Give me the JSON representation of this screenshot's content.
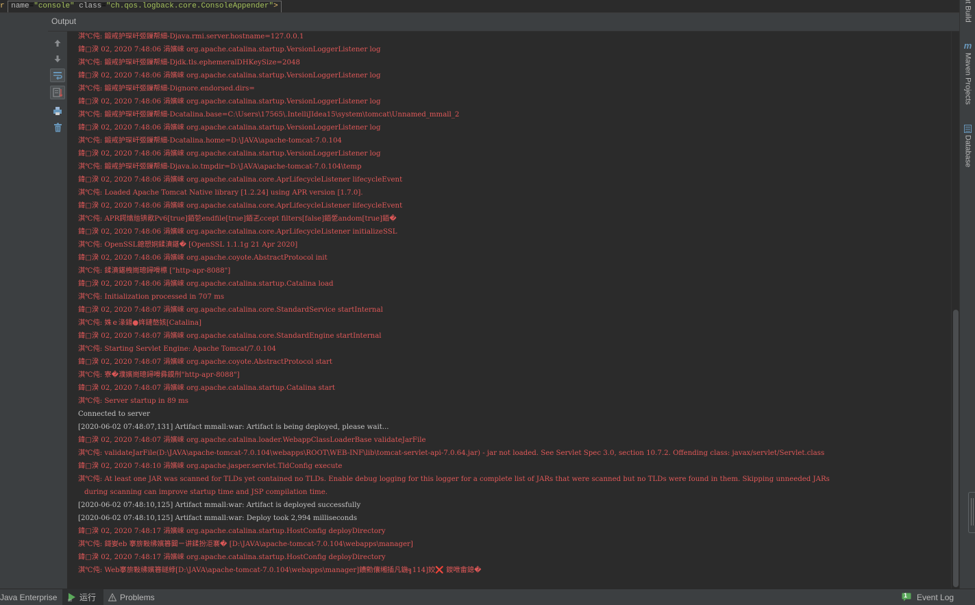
{
  "editor": {
    "attr_name": "name",
    "attr_name_value": "\"console\"",
    "attr_class": "class",
    "attr_class_value": "\"ch.qos.logback.core.ConsoleAppender\"",
    "tag_close": ">",
    "leading_glyph": "r"
  },
  "output_panel": {
    "title": "Output"
  },
  "toolbar": {
    "buttons": [
      {
        "icon": "up-arrow-icon",
        "label": "up"
      },
      {
        "icon": "down-arrow-icon",
        "label": "down"
      },
      {
        "icon": "soft-wrap-icon",
        "label": "wrap"
      },
      {
        "icon": "scroll-to-end-icon",
        "label": "scroll"
      },
      {
        "icon": "print-icon",
        "label": "print"
      },
      {
        "icon": "trash-icon",
        "label": "clear"
      }
    ]
  },
  "console": {
    "lines": [
      {
        "text": "淇℃伅: 鍛戒护琛屽弬鏁帮細-Djava.rmi.server.hostname=127.0.0.1",
        "type": "err"
      },
      {
        "text": "鍏□湀 02, 2020 7:48:06 涓嬪崍 org.apache.catalina.startup.VersionLoggerListener log",
        "type": "err"
      },
      {
        "text": "淇℃伅: 鍛戒护琛屽弬鏁帮細-Djdk.tls.ephemeralDHKeySize=2048",
        "type": "err"
      },
      {
        "text": "鍏□湀 02, 2020 7:48:06 涓嬪崍 org.apache.catalina.startup.VersionLoggerListener log",
        "type": "err"
      },
      {
        "text": "淇℃伅: 鍛戒护琛屽弬鏁帮細-Dignore.endorsed.dirs=",
        "type": "err"
      },
      {
        "text": "鍏□湀 02, 2020 7:48:06 涓嬪崍 org.apache.catalina.startup.VersionLoggerListener log",
        "type": "err"
      },
      {
        "text": "淇℃伅: 鍛戒护琛屽弬鏁帮細-Dcatalina.base=C:\\Users\\17565\\.IntelliJIdea15\\system\\tomcat\\Unnamed_mmall_2",
        "type": "err"
      },
      {
        "text": "鍏□湀 02, 2020 7:48:06 涓嬪崍 org.apache.catalina.startup.VersionLoggerListener log",
        "type": "err"
      },
      {
        "text": "淇℃伅: 鍛戒护琛屽弬鏁帮細-Dcatalina.home=D:\\JAVA\\apache-tomcat-7.0.104",
        "type": "err"
      },
      {
        "text": "鍏□湀 02, 2020 7:48:06 涓嬪崍 org.apache.catalina.startup.VersionLoggerListener log",
        "type": "err"
      },
      {
        "text": "淇℃伅: 鍛戒护琛屽弬鏁帮細-Djava.io.tmpdir=D:\\JAVA\\apache-tomcat-7.0.104\\temp",
        "type": "err"
      },
      {
        "text": "鍏□湀 02, 2020 7:48:06 涓嬪崍 org.apache.catalina.core.AprLifecycleListener lifecycleEvent",
        "type": "err"
      },
      {
        "text": "淇℃伅: Loaded Apache Tomcat Native library [1.2.24] using APR version [1.7.0].",
        "type": "err"
      },
      {
        "text": "鍏□湀 02, 2020 7:48:06 涓嬪崍 org.apache.catalina.core.AprLifecycleListener lifecycleEvent",
        "type": "err"
      },
      {
        "text": "淇℃伅: APR鍔熻兘锛歄Pv6[true]銆乻endfile[true]銆乤ccept filters[false]銆乺andom[true]銆�",
        "type": "err"
      },
      {
        "text": "鍏□湀 02, 2020 7:48:06 涓嬪崍 org.apache.catalina.core.AprLifecycleListener initializeSSL",
        "type": "err"
      },
      {
        "text": "淇℃伅: OpenSSL鎴愬姛鍒濆鍖� [OpenSSL 1.1.1g  21 Apr 2020]",
        "type": "err"
      },
      {
        "text": "鍏□湀 02, 2020 7:48:06 涓嬪崍 org.apache.coyote.AbstractProtocol init",
        "type": "err"
      },
      {
        "text": "淇℃伅: 鍒濆鍖栧崗璁鐞嗗櫒 [\"http-apr-8088\"]",
        "type": "err"
      },
      {
        "text": "鍏□湀 02, 2020 7:48:06 涓嬪崍 org.apache.catalina.startup.Catalina load",
        "type": "err"
      },
      {
        "text": "淇℃伅: Initialization processed in 707 ms",
        "type": "err"
      },
      {
        "text": "鍏□湀 02, 2020 7:48:07 涓嬪崍 org.apache.catalina.core.StandardService startInternal",
        "type": "err"
      },
      {
        "text": "淇℃伅: 姝ｅ湪鍚●姩鏈嶅姟[Catalina]",
        "type": "err"
      },
      {
        "text": "鍏□湀 02, 2020 7:48:07 涓嬪崍 org.apache.catalina.core.StandardEngine startInternal",
        "type": "err"
      },
      {
        "text": "淇℃伅: Starting Servlet Engine: Apache Tomcat/7.0.104",
        "type": "err"
      },
      {
        "text": "鍏□湀 02, 2020 7:48:07 涓嬪崍 org.apache.coyote.AbstractProtocol start",
        "type": "err"
      },
      {
        "text": "淇℃伅: 寮�濮嬪崗璁鐞嗗彞鏌刐\"http-apr-8088\"]",
        "type": "err"
      },
      {
        "text": "鍏□湀 02, 2020 7:48:07 涓嬪崍 org.apache.catalina.startup.Catalina start",
        "type": "err"
      },
      {
        "text": "淇℃伅: Server startup in 89 ms",
        "type": "err"
      },
      {
        "text": "Connected to server",
        "type": "out"
      },
      {
        "text": "[2020-06-02 07:48:07,131] Artifact mmall:war: Artifact is being deployed, please wait...",
        "type": "out"
      },
      {
        "text": "鍏□湀 02, 2020 7:48:07 涓嬪崍 org.apache.catalina.loader.WebappClassLoaderBase validateJarFile",
        "type": "err"
      },
      {
        "text": "淇℃伅: validateJarFile(D:\\JAVA\\apache-tomcat-7.0.104\\webapps\\ROOT\\WEB-INF\\lib\\tomcat-servlet-api-7.0.64.jar) - jar not loaded. See Servlet Spec 3.0, section 10.7.2. Offending class: javax/servlet/Servlet.class",
        "type": "err"
      },
      {
        "text": "鍏□湀 02, 2020 7:48:10 涓嬪崍 org.apache.jasper.servlet.TldConfig execute",
        "type": "err"
      },
      {
        "text": "淇℃伅: At least one JAR was scanned for TLDs yet contained no TLDs. Enable debug logging for this logger for a complete list of JARs that were scanned but no TLDs were found in them. Skipping unneeded JARs",
        "type": "err"
      },
      {
        "text": "during scanning can improve startup time and JSP compilation time.",
        "type": "err",
        "indent": true
      },
      {
        "text": "[2020-06-02 07:48:10,125] Artifact mmall:war: Artifact is deployed successfully",
        "type": "out"
      },
      {
        "text": "[2020-06-02 07:48:10,125] Artifact mmall:war: Deploy took 2,994 milliseconds",
        "type": "out"
      },
      {
        "text": "鍏□湀 02, 2020 7:48:17 涓嬪崍 org.apache.catalina.startup.HostConfig deployDirectory",
        "type": "err"
      },
      {
        "text": "淇℃伅: 鎶妛eb 搴旂敤绋嬪簭閮ㄧ讲鍒扮洰褰� [D:\\JAVA\\apache-tomcat-7.0.104\\webapps\\manager]",
        "type": "err"
      },
      {
        "text": "鍏□湀 02, 2020 7:48:17 涓嬪崍 org.apache.catalina.startup.HostConfig deployDirectory",
        "type": "err"
      },
      {
        "text": "淇℃伅: Web搴旂敤绋嬪簭鐩綍[D:\\JAVA\\apache-tomcat-7.0.104\\webapps\\manager]鐨勯儴缃插凡鍦╗114]姣❌ 鍐呭畬鎴�",
        "type": "err"
      }
    ]
  },
  "right_stripe": {
    "tabs": [
      {
        "label": "nt Build",
        "icon": ""
      },
      {
        "label": "Maven Projects",
        "icon": "maven-icon"
      },
      {
        "label": "Database",
        "icon": "database-icon"
      }
    ]
  },
  "bottom_bar": {
    "tabs": [
      {
        "label": "Java Enterprise",
        "icon": ""
      },
      {
        "label": "运行",
        "icon": "run-icon"
      },
      {
        "label": "Problems",
        "icon": "problems-icon"
      }
    ],
    "event_log": {
      "label": "Event Log",
      "badge": "1"
    }
  },
  "colors": {
    "error_text": "#e05858",
    "normal_text": "#c4c4c4",
    "background": "#2b2b2b",
    "panel": "#3c3f41",
    "run_green": "#5aa85a"
  }
}
